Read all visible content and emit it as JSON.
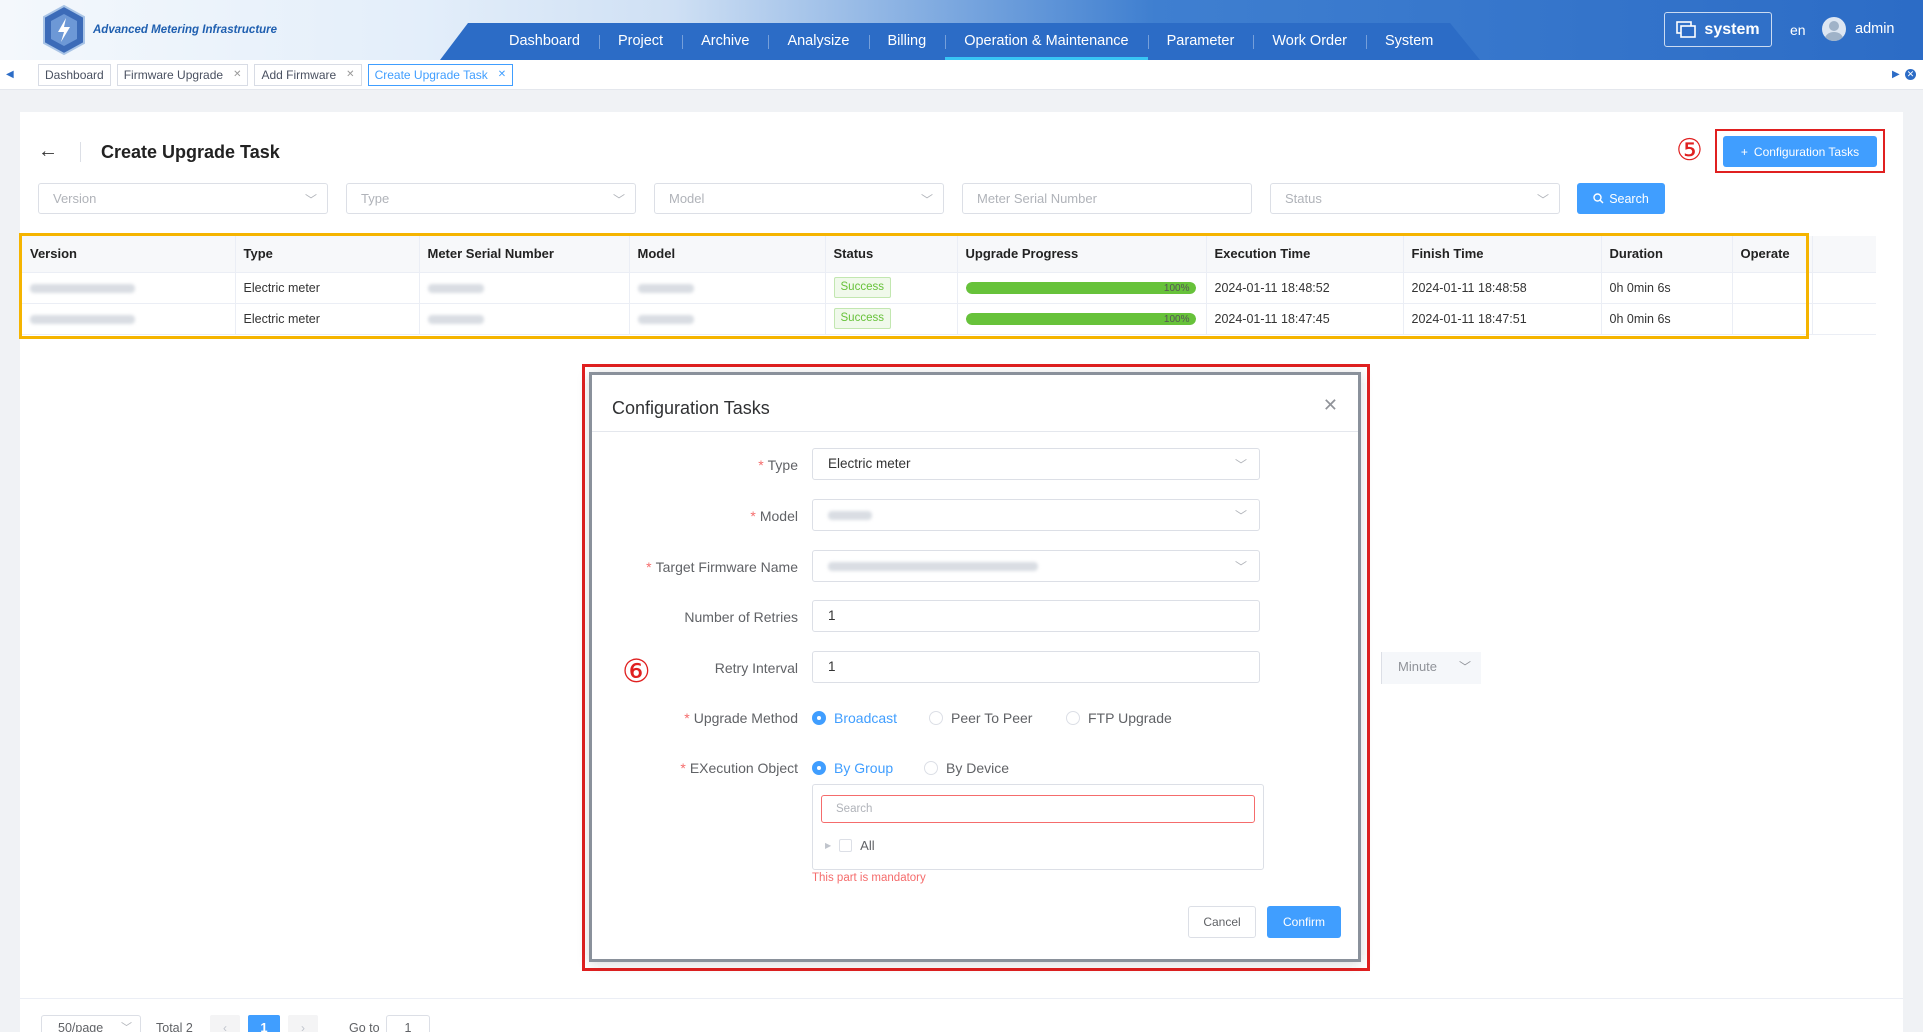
{
  "app": {
    "logo_text": "Advanced Metering Infrastructure",
    "nav": [
      "Dashboard",
      "Project",
      "Archive",
      "Analysize",
      "Billing",
      "Operation & Maintenance",
      "Parameter",
      "Work Order",
      "System"
    ],
    "active_nav": "Operation & Maintenance",
    "system_label": "system",
    "language": "en",
    "user": "admin"
  },
  "tabs": [
    {
      "label": "Dashboard",
      "closable": false
    },
    {
      "label": "Firmware Upgrade",
      "closable": true
    },
    {
      "label": "Add Firmware",
      "closable": true
    },
    {
      "label": "Create Upgrade Task",
      "closable": true,
      "active": true
    }
  ],
  "page": {
    "title": "Create Upgrade Task",
    "config_button": "Configuration Tasks",
    "annotation_5": "⑤",
    "annotation_6": "⑥"
  },
  "filters": {
    "version": "Version",
    "type": "Type",
    "model": "Model",
    "meter_serial": "Meter Serial Number",
    "status": "Status",
    "search_button": "Search"
  },
  "table": {
    "columns": [
      "Version",
      "Type",
      "Meter Serial Number",
      "Model",
      "Status",
      "Upgrade Progress",
      "Execution Time",
      "Finish Time",
      "Duration",
      "Operate"
    ],
    "rows": [
      {
        "type": "Electric meter",
        "status": "Success",
        "progress": 100,
        "progress_label": "100%",
        "execution_time": "2024-01-11 18:48:52",
        "finish_time": "2024-01-11 18:48:58",
        "duration": "0h 0min 6s"
      },
      {
        "type": "Electric meter",
        "status": "Success",
        "progress": 100,
        "progress_label": "100%",
        "execution_time": "2024-01-11 18:47:45",
        "finish_time": "2024-01-11 18:47:51",
        "duration": "0h 0min 6s"
      }
    ]
  },
  "modal": {
    "title": "Configuration Tasks",
    "type_label": "Type",
    "type_value": "Electric meter",
    "model_label": "Model",
    "firmware_label": "Target Firmware Name",
    "retries_label": "Number of Retries",
    "retries_value": "1",
    "interval_label": "Retry Interval",
    "interval_value": "1",
    "interval_unit": "Minute",
    "method_label": "Upgrade Method",
    "methods": [
      "Broadcast",
      "Peer To Peer",
      "FTP Upgrade"
    ],
    "selected_method": "Broadcast",
    "object_label": "EXecution Object",
    "objects": [
      "By Group",
      "By Device"
    ],
    "selected_object": "By Group",
    "tree_search_placeholder": "Search",
    "tree_root": "All",
    "error": "This part is mandatory",
    "cancel": "Cancel",
    "confirm": "Confirm"
  },
  "pagination": {
    "page_size": "50/page",
    "total": "Total 2",
    "current_page": "1",
    "goto_label": "Go to",
    "goto_value": "1"
  },
  "colors": {
    "primary": "#409eff",
    "header_blue": "#2c6cc6",
    "success": "#67c23a",
    "annotation_red": "#e02020",
    "highlight_yellow": "#f5b400"
  }
}
